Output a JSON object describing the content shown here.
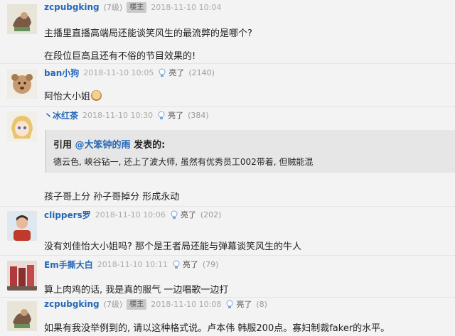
{
  "colors": {
    "username": "#2468b8",
    "background": "#f3f3f3",
    "quote_bg": "#e6e6e6"
  },
  "posts": [
    {
      "username": "zcpubgking",
      "level": "(7级)",
      "badge": "楼主",
      "time": "2018-11-10 10:04",
      "lines": [
        "主播里直播高端局还能谈笑风生的最流弊的是哪个?",
        "在段位巨高且还有不俗的节目效果的!"
      ]
    },
    {
      "username": "ban小狗",
      "time": "2018-11-10 10:05",
      "like_label": "亮了",
      "like_count": "(2140)",
      "lines": [
        "阿怡大小姐"
      ]
    },
    {
      "username": "丶冰红茶",
      "time": "2018-11-10 10:30",
      "like_label": "亮了",
      "like_count": "(384)",
      "quote": {
        "prefix": "引用",
        "user": "@大笨钟的雨",
        "suffix": "发表的:",
        "text": "德云色, 峡谷钻一, 还上了波大师, 虽然有优秀员工002带着, 但贼能混"
      },
      "lines": [
        "孩子哥上分 孙子哥掉分 形成永动"
      ]
    },
    {
      "username": "clippers罗",
      "time": "2018-11-10 10:06",
      "like_label": "亮了",
      "like_count": "(202)",
      "lines": [
        "没有刘佳怡大小姐吗? 那个是王者局还能与弹幕谈笑风生的牛人"
      ]
    },
    {
      "username": "Em手撕大白",
      "time": "2018-11-10 10:11",
      "like_label": "亮了",
      "like_count": "(79)",
      "lines": [
        "算上肉鸡的话, 我是真的服气 一边唱歌一边打"
      ]
    },
    {
      "username": "zcpubgking",
      "level": "(7级)",
      "badge": "楼主",
      "time": "2018-11-10 10:08",
      "like_label": "亮了",
      "like_count": "(8)",
      "lines": [
        "如果有我没举例到的, 请以这种格式说。卢本伟 韩服200点。寡妇制裁faker的水平。"
      ]
    }
  ]
}
